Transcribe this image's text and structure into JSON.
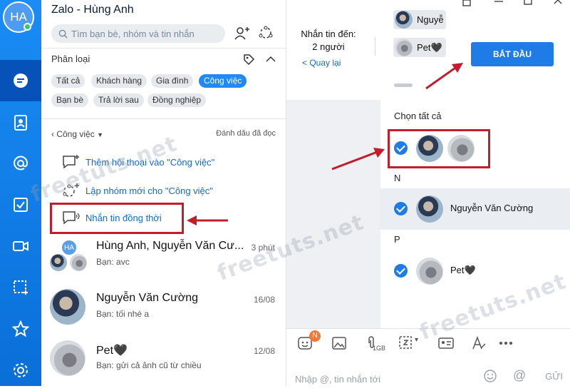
{
  "app": {
    "title": "Zalo - Hùng Anh",
    "avatar_initials": "HA"
  },
  "search": {
    "placeholder": "Tìm bạn bè, nhóm và tin nhắn"
  },
  "categories": {
    "title": "Phân loại",
    "tags": [
      {
        "label": "Tất cả",
        "active": false
      },
      {
        "label": "Khách hàng",
        "active": false
      },
      {
        "label": "Gia đình",
        "active": false
      },
      {
        "label": "Công việc",
        "active": true
      },
      {
        "label": "Bạn bè",
        "active": false
      },
      {
        "label": "Trả lời sau",
        "active": false
      },
      {
        "label": "Đồng nghiệp",
        "active": false
      }
    ]
  },
  "filter": {
    "current": "Công việc",
    "mark_read": "Đánh dấu đã đọc"
  },
  "actions": [
    {
      "label": "Thêm hội thoại vào \"Công việc\""
    },
    {
      "label": "Lập nhóm mới cho \"Công việc\""
    },
    {
      "label": "Nhắn tin đồng thời"
    }
  ],
  "conversations": [
    {
      "name": "Hùng Anh, Nguyễn Văn Cư...",
      "preview": "Bạn: avc",
      "time": "3 phút",
      "group_badge": "HA"
    },
    {
      "name": "Nguyễn Văn Cường",
      "preview": "Bạn: tối nhé a",
      "time": "16/08"
    },
    {
      "name": "Pet🖤",
      "preview": "Bạn: gửi cả ảnh cũ từ chiều",
      "time": "12/08"
    }
  ],
  "broadcast": {
    "to_label": "Nhắn tin đến:",
    "count_label": "2 người",
    "back_label": "< Quay lại",
    "recipients": [
      "Nguyễ",
      "Pet🖤"
    ],
    "start_button": "BẮT ĐẦU"
  },
  "picker": {
    "select_all": "Chọn tất cả",
    "groups": [
      {
        "letter": "N",
        "contacts": [
          "Nguyễn Văn Cường"
        ]
      },
      {
        "letter": "P",
        "contacts": [
          "Pet🖤"
        ]
      }
    ]
  },
  "composer": {
    "placeholder": "Nhập @, tin nhắn tới",
    "send_label": "GỬI",
    "file_limit": "1GB",
    "badge": "N"
  },
  "watermark": "freetuts.net",
  "colors": {
    "rail": "#0a6fd8",
    "accent": "#1f7be6",
    "highlight_box": "#c11d2a"
  }
}
